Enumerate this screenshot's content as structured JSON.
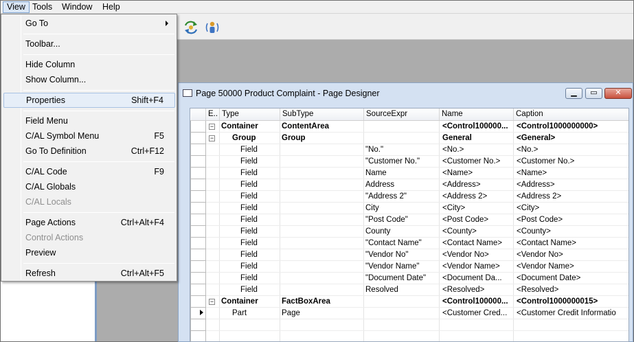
{
  "menubar": [
    "View",
    "Tools",
    "Window",
    "Help"
  ],
  "view_menu": {
    "items": [
      {
        "label": "Go To",
        "shortcut": "",
        "disabled": false,
        "submenu": true
      },
      {
        "label": "Toolbar...",
        "shortcut": "",
        "disabled": false
      },
      {
        "label": "Hide Column",
        "shortcut": "",
        "disabled": false
      },
      {
        "label": "Show Column...",
        "shortcut": "",
        "disabled": false
      },
      {
        "label": "Properties",
        "shortcut": "Shift+F4",
        "disabled": false,
        "highlighted": true
      },
      {
        "label": "Field Menu",
        "shortcut": "",
        "disabled": false
      },
      {
        "label": "C/AL Symbol Menu",
        "shortcut": "F5",
        "disabled": false
      },
      {
        "label": "Go To Definition",
        "shortcut": "Ctrl+F12",
        "disabled": false
      },
      {
        "label": "C/AL Code",
        "shortcut": "F9",
        "disabled": false
      },
      {
        "label": "C/AL Globals",
        "shortcut": "",
        "disabled": false
      },
      {
        "label": "C/AL Locals",
        "shortcut": "",
        "disabled": true
      },
      {
        "label": "Page Actions",
        "shortcut": "Ctrl+Alt+F4",
        "disabled": false
      },
      {
        "label": "Control Actions",
        "shortcut": "",
        "disabled": true
      },
      {
        "label": "Preview",
        "shortcut": "",
        "disabled": false
      },
      {
        "label": "Refresh",
        "shortcut": "Ctrl+Alt+F5",
        "disabled": false
      }
    ]
  },
  "toolbar": {
    "icons": [
      "refresh-arrows-icon",
      "user-signal-icon"
    ]
  },
  "designer": {
    "title": "Page 50000 Product Complaint - Page Designer",
    "columns": [
      "E..",
      "Type",
      "SubType",
      "SourceExpr",
      "Name",
      "Caption"
    ],
    "rows": [
      {
        "exp": "⊟",
        "type": "Container",
        "subtype": "ContentArea",
        "source": "",
        "name": "<Control100000...",
        "caption": "<Control1000000000>",
        "bold": true,
        "level": 0
      },
      {
        "exp": "⊟",
        "type": "Group",
        "subtype": "Group",
        "source": "",
        "name": "General",
        "caption": "<General>",
        "bold": true,
        "level": 1
      },
      {
        "exp": "",
        "type": "Field",
        "subtype": "",
        "source": "\"No.\"",
        "name": "<No.>",
        "caption": "<No.>",
        "bold": false,
        "level": 2
      },
      {
        "exp": "",
        "type": "Field",
        "subtype": "",
        "source": "\"Customer No.\"",
        "name": "<Customer No.>",
        "caption": "<Customer No.>",
        "bold": false,
        "level": 2
      },
      {
        "exp": "",
        "type": "Field",
        "subtype": "",
        "source": "Name",
        "name": "<Name>",
        "caption": "<Name>",
        "bold": false,
        "level": 2
      },
      {
        "exp": "",
        "type": "Field",
        "subtype": "",
        "source": "Address",
        "name": "<Address>",
        "caption": "<Address>",
        "bold": false,
        "level": 2
      },
      {
        "exp": "",
        "type": "Field",
        "subtype": "",
        "source": "\"Address 2\"",
        "name": "<Address 2>",
        "caption": "<Address 2>",
        "bold": false,
        "level": 2
      },
      {
        "exp": "",
        "type": "Field",
        "subtype": "",
        "source": "City",
        "name": "<City>",
        "caption": "<City>",
        "bold": false,
        "level": 2
      },
      {
        "exp": "",
        "type": "Field",
        "subtype": "",
        "source": "\"Post Code\"",
        "name": "<Post Code>",
        "caption": "<Post Code>",
        "bold": false,
        "level": 2
      },
      {
        "exp": "",
        "type": "Field",
        "subtype": "",
        "source": "County",
        "name": "<County>",
        "caption": "<County>",
        "bold": false,
        "level": 2
      },
      {
        "exp": "",
        "type": "Field",
        "subtype": "",
        "source": "\"Contact Name\"",
        "name": "<Contact Name>",
        "caption": "<Contact Name>",
        "bold": false,
        "level": 2
      },
      {
        "exp": "",
        "type": "Field",
        "subtype": "",
        "source": "\"Vendor No\"",
        "name": "<Vendor No>",
        "caption": "<Vendor No>",
        "bold": false,
        "level": 2
      },
      {
        "exp": "",
        "type": "Field",
        "subtype": "",
        "source": "\"Vendor Name\"",
        "name": "<Vendor Name>",
        "caption": "<Vendor Name>",
        "bold": false,
        "level": 2
      },
      {
        "exp": "",
        "type": "Field",
        "subtype": "",
        "source": "\"Document Date\"",
        "name": "<Document Da...",
        "caption": "<Document Date>",
        "bold": false,
        "level": 2
      },
      {
        "exp": "",
        "type": "Field",
        "subtype": "",
        "source": "Resolved",
        "name": "<Resolved>",
        "caption": "<Resolved>",
        "bold": false,
        "level": 2
      },
      {
        "exp": "⊟",
        "type": "Container",
        "subtype": "FactBoxArea",
        "source": "",
        "name": "<Control100000...",
        "caption": "<Control1000000015>",
        "bold": true,
        "level": 0
      },
      {
        "exp": "",
        "type": "Part",
        "subtype": "Page",
        "source": "",
        "name": "<Customer Cred...",
        "caption": "<Customer Credit Informatio",
        "bold": false,
        "level": 1,
        "current": true
      }
    ]
  }
}
